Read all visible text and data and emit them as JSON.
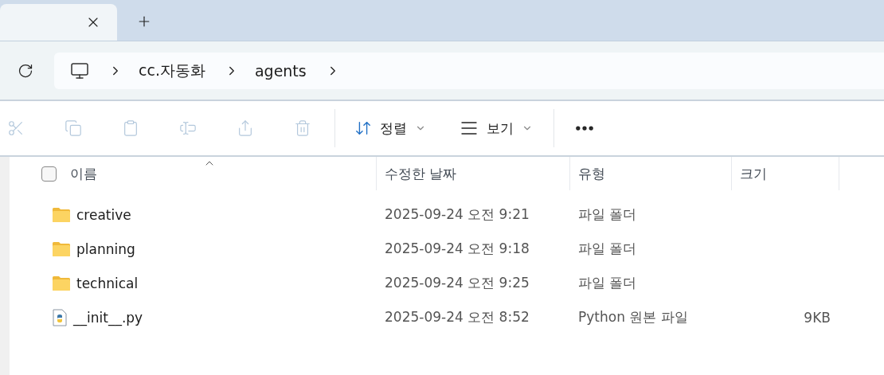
{
  "tabs": [
    {
      "selected": true
    }
  ],
  "address": {
    "crumbs": [
      "cc.자동화",
      "agents"
    ]
  },
  "toolbar": {
    "actions": [
      {
        "kind": "cut",
        "disabled": true
      },
      {
        "kind": "copy",
        "disabled": true
      },
      {
        "kind": "paste",
        "disabled": true
      },
      {
        "kind": "rename",
        "disabled": true
      },
      {
        "kind": "share",
        "disabled": true
      },
      {
        "kind": "delete",
        "disabled": true
      }
    ],
    "sort": {
      "label": "정렬"
    },
    "view": {
      "label": "보기"
    }
  },
  "table": {
    "select_all": {
      "checked": false
    },
    "columns": [
      {
        "label": "이름",
        "sorted": true
      },
      {
        "label": "수정한 날짜",
        "sorted": false
      },
      {
        "label": "유형",
        "sorted": false
      },
      {
        "label": "크기",
        "sorted": false
      }
    ],
    "rows": [
      {
        "kind": "folder",
        "name": "creative",
        "modified": "2025-09-24 오전 9:21",
        "type": "파일 폴더"
      },
      {
        "kind": "folder",
        "name": "planning",
        "modified": "2025-09-24 오전 9:18",
        "type": "파일 폴더"
      },
      {
        "kind": "folder",
        "name": "technical",
        "modified": "2025-09-24 오전 9:25",
        "type": "파일 폴더"
      },
      {
        "kind": "python",
        "name": "__init__.py",
        "modified": "2025-09-24 오전 8:52",
        "type": "Python 원본 파일",
        "size": "9KB"
      }
    ]
  }
}
